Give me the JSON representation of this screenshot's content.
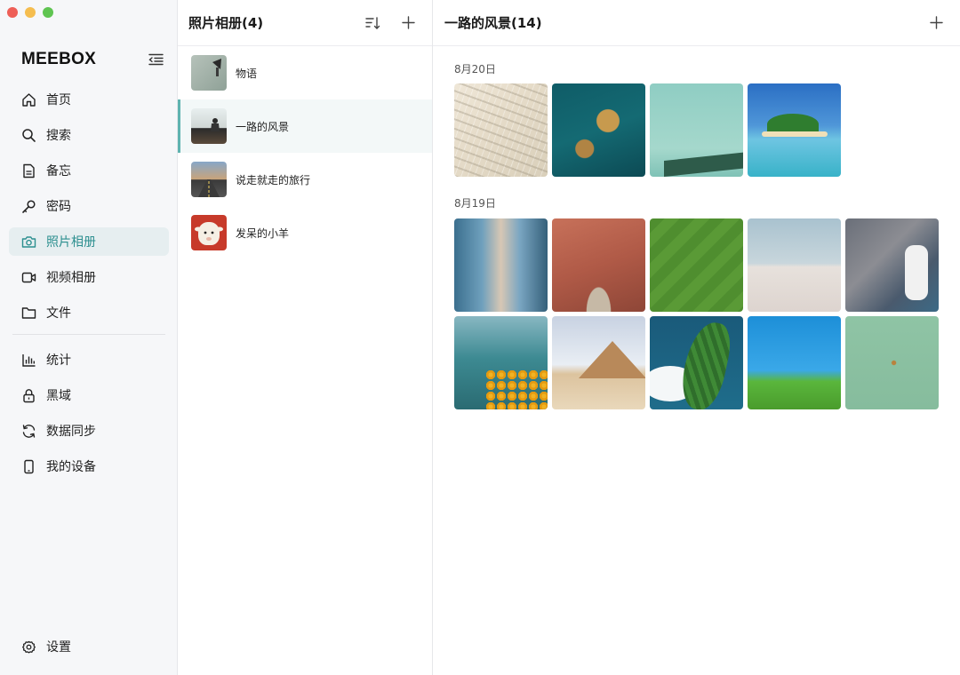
{
  "window": {
    "traffic": {
      "close": "#ee5f57",
      "minimize": "#f5bd4f",
      "zoom": "#5fc451"
    }
  },
  "sidebar": {
    "brand": "MEEBOX",
    "collapse_icon": "menu-collapse-icon",
    "items": [
      {
        "label": "首页",
        "icon": "home-icon"
      },
      {
        "label": "搜索",
        "icon": "search-icon"
      },
      {
        "label": "备忘",
        "icon": "note-icon"
      },
      {
        "label": "密码",
        "icon": "key-icon"
      },
      {
        "label": "照片相册",
        "icon": "camera-icon",
        "active": true
      },
      {
        "label": "视频相册",
        "icon": "video-icon"
      },
      {
        "label": "文件",
        "icon": "folder-icon"
      },
      {
        "label": "统计",
        "icon": "chart-icon"
      },
      {
        "label": "黑域",
        "icon": "lock-icon"
      },
      {
        "label": "数据同步",
        "icon": "sync-icon"
      },
      {
        "label": "我的设备",
        "icon": "phone-icon"
      }
    ],
    "settings": {
      "label": "设置",
      "icon": "gear-icon"
    },
    "accent": "#2c8f8f"
  },
  "albums": {
    "title": "照片相册(4)",
    "sort_icon": "sort-icon",
    "add_icon": "plus-icon",
    "items": [
      {
        "name": "物语"
      },
      {
        "name": "一路的风景",
        "active": true
      },
      {
        "name": "说走就走的旅行"
      },
      {
        "name": "发呆的小羊"
      }
    ]
  },
  "main": {
    "title": "一路的风景(14)",
    "add_icon": "plus-icon",
    "sections": [
      {
        "date": "8月20日",
        "count": 4
      },
      {
        "date": "8月19日",
        "count": 10
      }
    ]
  }
}
